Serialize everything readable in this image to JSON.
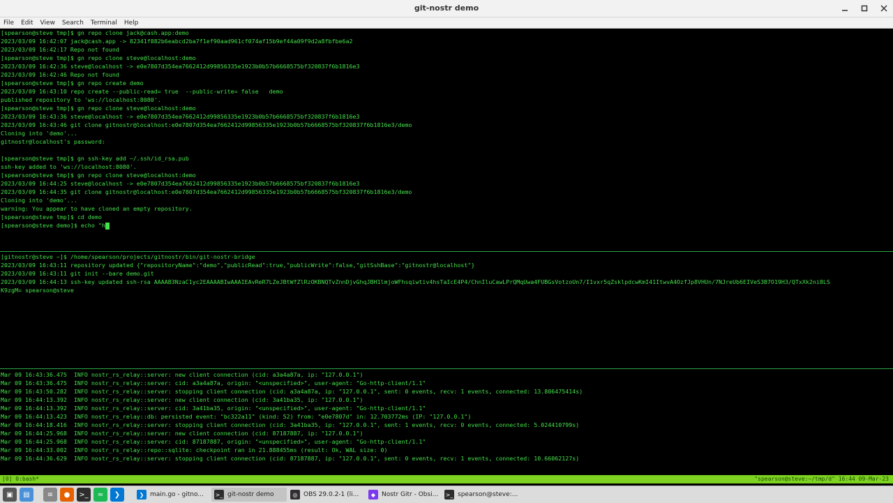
{
  "window": {
    "title": "git-nostr demo"
  },
  "menu": [
    "File",
    "Edit",
    "View",
    "Search",
    "Terminal",
    "Help"
  ],
  "pane1": [
    "[spearson@steve tmp]$ gn repo clone jack@cash.app:demo",
    "2023/03/09 16:42:07 jack@cash.app -> 82341f882b6eabcd2ba7f1ef90aad961cf074af15b9ef44a09f9d2a8fbfbe6a2",
    "2023/03/09 16:42:17 Repo not found",
    "[spearson@steve tmp]$ gn repo clone steve@localhost:demo",
    "2023/03/09 16:42:36 steve@localhost -> e0e7807d354ea7662412d99856335e1923b0b57b6668575bf320837f6b1816e3",
    "2023/03/09 16:42:46 Repo not found",
    "[spearson@steve tmp]$ gn repo create demo",
    "2023/03/09 16:43:10 repo create --public-read= true  --public-write= false   demo",
    "published repository to 'ws://localhost:8080'.",
    "[spearson@steve tmp]$ gn repo clone steve@localhost:demo",
    "2023/03/09 16:43:36 steve@localhost -> e0e7807d354ea7662412d99856335e1923b0b57b6668575bf320837f6b1816e3",
    "2023/03/09 16:43:46 git clone gitnostr@localhost:e0e7807d354ea7662412d99856335e1923b0b57b6668575bf320837f6b1816e3/demo",
    "Cloning into 'demo'...",
    "gitnostr@localhost's password:",
    "",
    "[spearson@steve tmp]$ gn ssh-key add ~/.ssh/id_rsa.pub",
    "ssh-key added to 'ws://localhost:8080'.",
    "[spearson@steve tmp]$ gn repo clone steve@localhost:demo",
    "2023/03/09 16:44:25 steve@localhost -> e0e7807d354ea7662412d99856335e1923b0b57b6668575bf320837f6b1816e3",
    "2023/03/09 16:44:35 git clone gitnostr@localhost:e0e7807d354ea7662412d99856335e1923b0b57b6668575bf320837f6b1816e3/demo",
    "Cloning into 'demo'...",
    "warning: You appear to have cloned an empty repository.",
    "[spearson@steve tmp]$ cd demo"
  ],
  "pane1_prompt": "[spearson@steve demo]$ echo \"h",
  "pane2": [
    "[gitnostr@steve ~]$ /home/spearson/projects/gitnostr/bin/git-nostr-bridge",
    "2023/03/09 16:43:11 repository updated {\"repositoryName\":\"demo\",\"publicRead\":true,\"publicWrite\":false,\"gitSshBase\":\"gitnostr@localhost\"}",
    "2023/03/09 16:43:11 git init --bare demo.git",
    "2023/03/09 16:44:13 ssh-key updated ssh-rsa AAAAB3NzaC1yc2EAAAABIwAAAIEAvReR7LZeJBtWfZlRzOKBNQTvZnnDjvGhqJBH1lmjoWFhsqiwtiv4hsTaIcE4P4/ChnIluCawLPrQMqUwa4FUBGsVotzoUn7/I1vxr5qZsklpdcwKmI41ItwvA4OzfJp8VHUn/7NJreUb6EIVeS3B7O19H3/QTxXk2ni8LS",
    "K9zgM= spearson@steve"
  ],
  "pane3": [
    "Mar 09 16:43:36.475  INFO nostr_rs_relay::server: new client connection (cid: a3a4a87a, ip: \"127.0.0.1\")",
    "Mar 09 16:43:36.475  INFO nostr_rs_relay::server: cid: a3a4a87a, origin: \"<unspecified>\", user-agent: \"Go-http-client/1.1\"",
    "Mar 09 16:43:50.282  INFO nostr_rs_relay::server: stopping client connection (cid: a3a4a87a, ip: \"127.0.0.1\", sent: 0 events, recv: 1 events, connected: 13.806475414s)",
    "Mar 09 16:44:13.392  INFO nostr_rs_relay::server: new client connection (cid: 3a41ba35, ip: \"127.0.0.1\")",
    "Mar 09 16:44:13.392  INFO nostr_rs_relay::server: cid: 3a41ba35, origin: \"<unspecified>\", user-agent: \"Go-http-client/1.1\"",
    "Mar 09 16:44:13.423  INFO nostr_rs_relay::db: persisted event: \"bc322a11\" (kind: 52) from: \"e0e7807d\" in: 12.703772ms (IP: \"127.0.0.1\")",
    "Mar 09 16:44:18.416  INFO nostr_rs_relay::server: stopping client connection (cid: 3a41ba35, ip: \"127.0.0.1\", sent: 1 events, recv: 0 events, connected: 5.024410799s)",
    "Mar 09 16:44:25.968  INFO nostr_rs_relay::server: new client connection (cid: 87187887, ip: \"127.0.0.1\")",
    "Mar 09 16:44:25.968  INFO nostr_rs_relay::server: cid: 87187887, origin: \"<unspecified>\", user-agent: \"Go-http-client/1.1\"",
    "Mar 09 16:44:33.002  INFO nostr_rs_relay::repo::sqlite: checkpoint ran in 21.888455ms (result: Ok, WAL size: 0)",
    "Mar 09 16:44:36.629  INFO nostr_rs_relay::server: stopping client connection (cid: 87187887, ip: \"127.0.0.1\", sent: 0 events, recv: 1 events, connected: 10.66062127s)"
  ],
  "tmux": {
    "left": "[0] 0:bash*",
    "right": "\"spearson@steve:~/tmp/d\" 16:44 09-Mar-23"
  },
  "taskbar": {
    "launchers": [
      {
        "name": "activities-icon",
        "color": "#555555"
      },
      {
        "name": "files-icon",
        "color": "#4a90d9"
      },
      {
        "name": "text-editor-icon",
        "color": "#888888"
      },
      {
        "name": "firefox-icon",
        "color": "#e66000"
      },
      {
        "name": "terminal-icon",
        "color": "#2d2d2d"
      },
      {
        "name": "spotify-icon",
        "color": "#1db954"
      },
      {
        "name": "vscode-icon",
        "color": "#0078d4"
      }
    ],
    "tasks": [
      {
        "label": "main.go - gitno...",
        "icon": "vscode-icon",
        "color": "#0078d4",
        "active": false
      },
      {
        "label": "git-nostr demo",
        "icon": "terminal-icon",
        "color": "#2d2d2d",
        "active": true
      },
      {
        "label": "OBS 29.0.2-1 (li...",
        "icon": "obs-icon",
        "color": "#302e31",
        "active": false
      },
      {
        "label": "Nostr Gitr - Obsi...",
        "icon": "obsidian-icon",
        "color": "#7c3aed",
        "active": false
      },
      {
        "label": "spearson@steve:...",
        "icon": "terminal-icon",
        "color": "#2d2d2d",
        "active": false
      }
    ]
  }
}
